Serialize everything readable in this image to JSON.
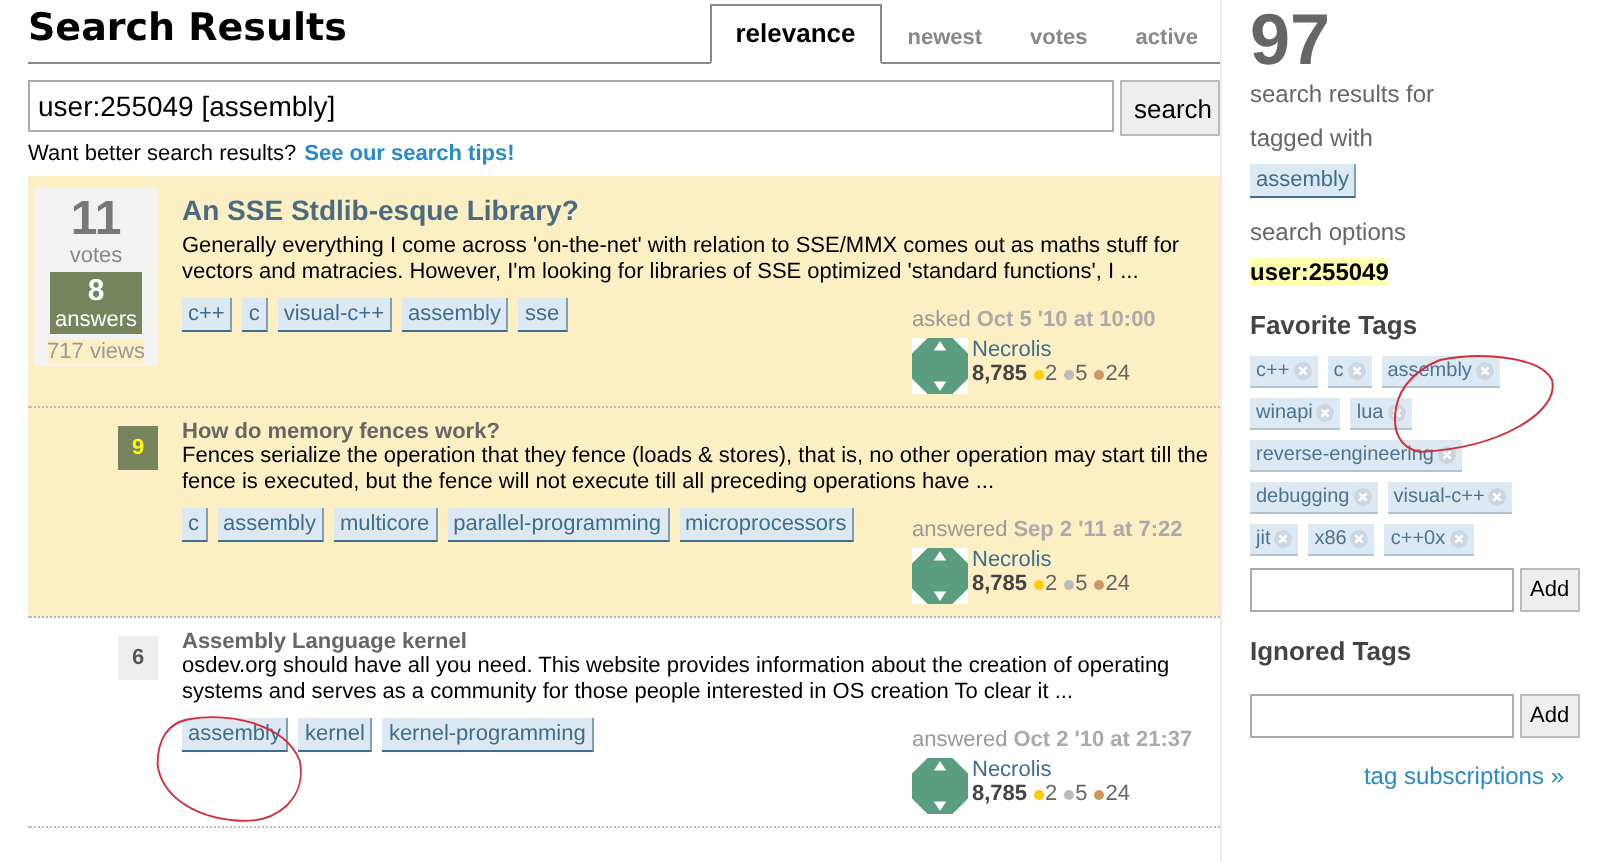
{
  "header": {
    "title": "Search Results",
    "tabs": [
      {
        "label": "relevance",
        "selected": true
      },
      {
        "label": "newest",
        "selected": false
      },
      {
        "label": "votes",
        "selected": false
      },
      {
        "label": "active",
        "selected": false
      }
    ]
  },
  "search": {
    "value": "user:255049 [assembly]",
    "button": "search",
    "tip": "Want better search results?",
    "tip_link": "See our search tips!"
  },
  "results": [
    {
      "kind": "question",
      "highlighted": true,
      "votes": "11",
      "votes_label": "votes",
      "answers": "8",
      "answers_label": "answers",
      "views": "717 views",
      "title": "An SSE Stdlib-esque Library?",
      "excerpt": "Generally everything I come across 'on-the-net' with relation to SSE/MMX comes out as maths stuff for vectors and matracies. However, I'm looking for libraries of SSE optimized 'standard functions', I ...",
      "tags": [
        "c++",
        "c",
        "visual-c++",
        "assembly",
        "sse"
      ],
      "action": "asked",
      "time": "Oct 5 '10 at 10:00",
      "user": "Necrolis",
      "rep": "8,785",
      "gold": "2",
      "silver": "5",
      "bronze": "24"
    },
    {
      "kind": "answer",
      "highlighted": true,
      "score": "9",
      "accepted": true,
      "title": "How do memory fences work?",
      "excerpt": "Fences serialize the operation that they fence (loads & stores), that is, no other operation may start till the fence is executed, but the fence will not execute till all preceding operations have ...",
      "tags": [
        "c",
        "assembly",
        "multicore",
        "parallel-programming",
        "microprocessors"
      ],
      "action": "answered",
      "time": "Sep 2 '11 at 7:22",
      "user": "Necrolis",
      "rep": "8,785",
      "gold": "2",
      "silver": "5",
      "bronze": "24"
    },
    {
      "kind": "answer",
      "highlighted": false,
      "score": "6",
      "accepted": false,
      "title": "Assembly Language kernel",
      "excerpt": "osdev.org should have all you need. This website provides information about the creation of operating systems and serves as a community for those people interested in OS creation To clear it ...",
      "tags": [
        "assembly",
        "kernel",
        "kernel-programming"
      ],
      "action": "answered",
      "time": "Oct 2 '10 at 21:37",
      "user": "Necrolis",
      "rep": "8,785",
      "gold": "2",
      "silver": "5",
      "bronze": "24"
    }
  ],
  "sidebar": {
    "count": "97",
    "count_label": "search results for",
    "tagged_label": "tagged with",
    "tagged": [
      "assembly"
    ],
    "options_label": "search options",
    "option": "user:255049",
    "favorite_title": "Favorite Tags",
    "favorite_tags": [
      "c++",
      "c",
      "assembly",
      "winapi",
      "lua",
      "reverse-engineering",
      "debugging",
      "visual-c++",
      "jit",
      "x86",
      "c++0x"
    ],
    "favorite_add": "Add",
    "ignored_title": "Ignored Tags",
    "ignored_add": "Add",
    "subscriptions": "tag subscriptions »"
  }
}
